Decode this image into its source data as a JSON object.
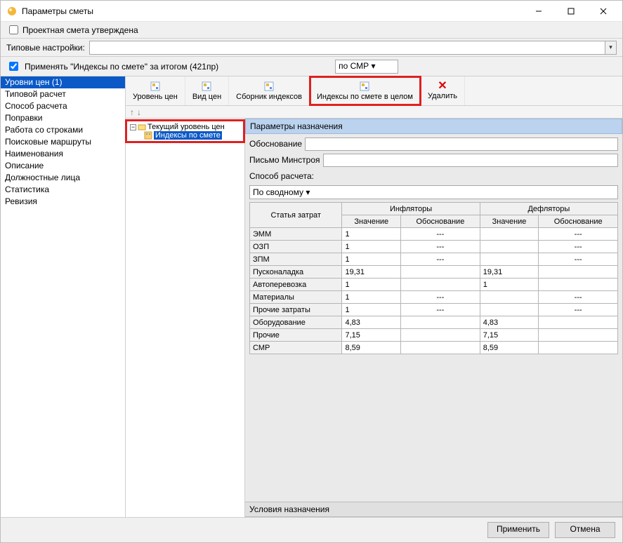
{
  "window": {
    "title": "Параметры сметы"
  },
  "approved": {
    "label": "Проектная смета утверждена",
    "checked": false
  },
  "typical": {
    "label": "Типовые настройки:",
    "value": ""
  },
  "apply": {
    "checked": true,
    "label": "Применять \"Индексы по смете\" за итогом (421пр)",
    "combo_label": "по СМР"
  },
  "sidebar": {
    "items": [
      "Уровни цен (1)",
      "Типовой расчет",
      "Способ расчета",
      "Поправки",
      "Работа со строками",
      "Поисковые маршруты",
      "Наименования",
      "Описание",
      "Должностные лица",
      "Статистика",
      "Ревизия"
    ],
    "selected": 0
  },
  "toolbar": [
    {
      "name": "level-price",
      "label": "Уровень цен"
    },
    {
      "name": "view-price",
      "label": "Вид цен"
    },
    {
      "name": "index-coll",
      "label": "Сборник индексов"
    },
    {
      "name": "index-all",
      "label": "Индексы по смете в целом",
      "highlight": true
    },
    {
      "name": "delete",
      "label": "Удалить",
      "delete": true
    }
  ],
  "tree": {
    "root": "Текущий уровень цен",
    "child": "Индексы по смете"
  },
  "form": {
    "header": "Параметры назначения",
    "rows": {
      "osnov": "Обоснование",
      "pismo_label": "Письмо Минстроя",
      "pismo_value": "",
      "method_label": "Способ расчета:",
      "method_value": "По сводному"
    },
    "table": {
      "header_cost": "Статья затрат",
      "group_inf": "Инфляторы",
      "group_def": "Дефляторы",
      "col_val": "Значение",
      "col_osn": "Обоснование",
      "rows": [
        {
          "name": "ЭММ",
          "iv": "1",
          "io": "---",
          "dv": "",
          "do": "---"
        },
        {
          "name": "ОЗП",
          "iv": "1",
          "io": "---",
          "dv": "",
          "do": "---"
        },
        {
          "name": "ЗПМ",
          "iv": "1",
          "io": "---",
          "dv": "",
          "do": "---"
        },
        {
          "name": "Пусконаладка",
          "iv": "19,31",
          "io": "",
          "dv": "19,31",
          "do": ""
        },
        {
          "name": "Автоперевозка",
          "iv": "1",
          "io": "",
          "dv": "1",
          "do": ""
        },
        {
          "name": "Материалы",
          "iv": "1",
          "io": "---",
          "dv": "",
          "do": "---"
        },
        {
          "name": "Прочие затраты",
          "iv": "1",
          "io": "---",
          "dv": "",
          "do": "---"
        },
        {
          "name": "Оборудование",
          "iv": "4,83",
          "io": "",
          "dv": "4,83",
          "do": ""
        },
        {
          "name": "Прочие",
          "iv": "7,15",
          "io": "",
          "dv": "7,15",
          "do": ""
        },
        {
          "name": "СМР",
          "iv": "8,59",
          "io": "",
          "dv": "8,59",
          "do": ""
        }
      ]
    },
    "cond_header": "Условия назначения"
  },
  "footer": {
    "apply": "Применить",
    "cancel": "Отмена"
  }
}
